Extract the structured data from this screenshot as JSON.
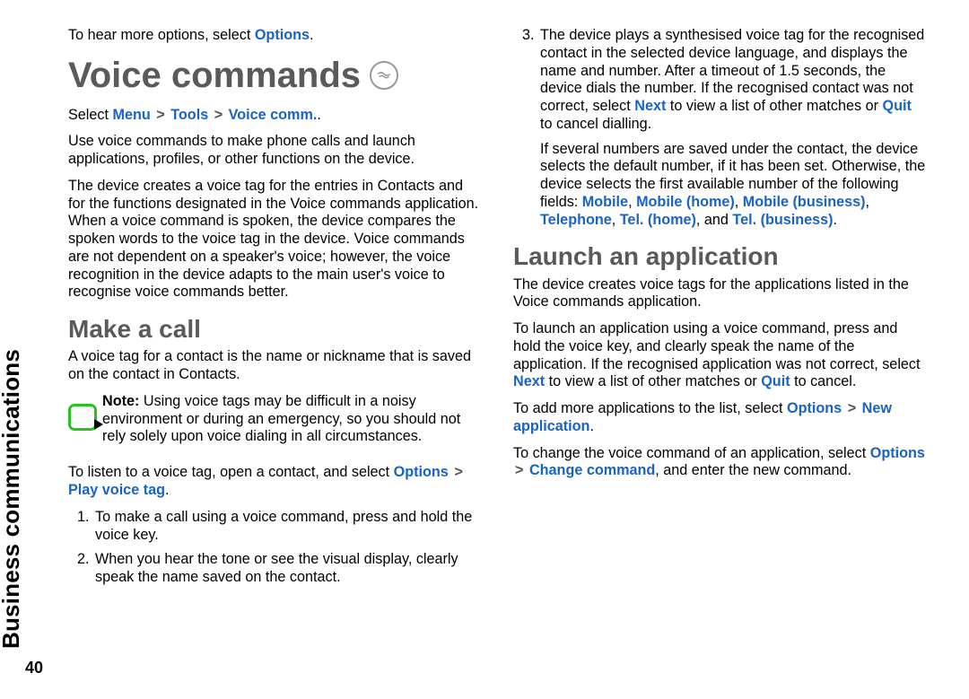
{
  "sidebar": {
    "section_label": "Business communications"
  },
  "page_number": "40",
  "left": {
    "intro_options": {
      "pre": "To hear more options, select ",
      "hl": "Options",
      "post": "."
    },
    "title": "Voice commands",
    "nav_path": {
      "prefix": "Select ",
      "p1": "Menu",
      "p2": "Tools",
      "p3": "Voice comm.",
      "suffix": "."
    },
    "para1": "Use voice commands to make phone calls and launch applications, profiles, or other functions on the device.",
    "para2": "The device creates a voice tag for the entries in Contacts and for the functions designated in the Voice commands application. When a voice command is spoken, the device compares the spoken words to the voice tag in the device. Voice commands are not dependent on a speaker's voice; however, the voice recognition in the device adapts to the main user's voice to recognise voice commands better.",
    "sub1": "Make a call",
    "makecall_para1": "A voice tag for a contact is the name or nickname that is saved on the contact in Contacts.",
    "note": {
      "label": "Note:",
      "text": "  Using voice tags may be difficult in a noisy environment or during an emergency, so you should not rely solely upon voice dialing in all circumstances."
    },
    "listen": {
      "pre": "To listen to a voice tag, open a contact, and select ",
      "p1": "Options",
      "p2": "Play voice tag",
      "post": "."
    },
    "step1": "To make a call using a voice command, press and hold the voice key.",
    "step2": "When you hear the tone or see the visual display, clearly speak the name saved on the contact."
  },
  "right": {
    "step3": {
      "pre": "The device plays a synthesised voice tag for the recognised contact in the selected device language, and displays the name and number. After a timeout of 1.5 seconds, the device dials the number. If the recognised contact was not correct, select ",
      "next": "Next",
      "mid": " to view a list of other matches or ",
      "quit": "Quit",
      "post": " to cancel dialling."
    },
    "multi": {
      "pre": "If several numbers are saved under the contact, the device selects the default number, if it has been set. Otherwise, the device selects the first available number of the following fields: ",
      "f1": "Mobile",
      "f2": "Mobile (home)",
      "f3": "Mobile (business)",
      "f4": "Telephone",
      "f5": "Tel. (home)",
      "f6": "Tel. (business)",
      "and": ", and ",
      "post": "."
    },
    "sub": "Launch an application",
    "la_para1": "The device creates voice tags for the applications listed in the Voice commands application.",
    "la_para2": {
      "pre": "To launch an application using a voice command, press and hold the voice key, and clearly speak the name of the application. If the recognised application was not correct, select ",
      "next": "Next",
      "mid": " to view a list of other matches or ",
      "quit": "Quit",
      "post": " to cancel."
    },
    "la_para3": {
      "pre": "To add more applications to the list, select ",
      "p1": "Options",
      "p2": "New application",
      "post": "."
    },
    "la_para4": {
      "pre": "To change the voice command of an application, select ",
      "p1": "Options",
      "p2": "Change command",
      "post": ", and enter the new command."
    }
  }
}
